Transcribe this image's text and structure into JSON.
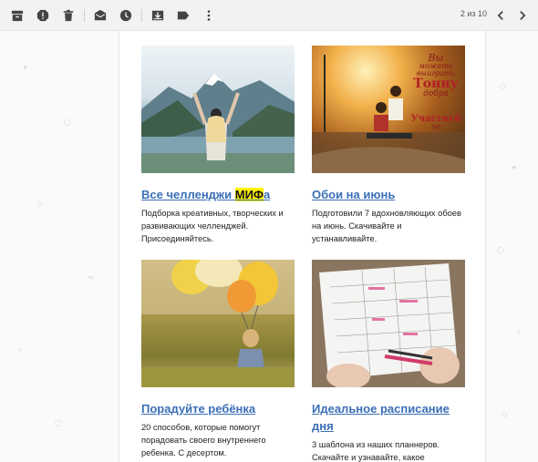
{
  "toolbar": {
    "icons": [
      "archive-icon",
      "report-spam-icon",
      "delete-icon",
      "mark-unread-icon",
      "snooze-icon",
      "move-to-icon",
      "label-icon",
      "more-icon"
    ],
    "pager_text": "2 из 10"
  },
  "cards": [
    {
      "title_prefix": "Все челленджи ",
      "title_highlight": "МИФ",
      "title_suffix": "а",
      "desc": "Подборка креативных, творческих и развивающих челленджей. Присоединяйтесь."
    },
    {
      "title": "Обои на июнь",
      "desc": "Подготовили 7 вдохновляющих обоев на июнь. Скачивайте и устанавливайте.",
      "image_text": [
        "Вы",
        "можете",
        "выиграть",
        "Тонну",
        "добра",
        "Участвуй",
        "те"
      ]
    },
    {
      "title": "Порадуйте ребёнка",
      "desc": "20 способов, которые помогут порадовать своего внутреннего ребенка. С десертом."
    },
    {
      "title": "Идеальное расписание дня",
      "desc": "3 шаблона из наших планнеров. Скачайте и узнавайте, какое"
    }
  ],
  "colors": {
    "link": "#3a6fb7",
    "highlight": "#fff200",
    "toolbar_bg": "#f2f2f2"
  }
}
